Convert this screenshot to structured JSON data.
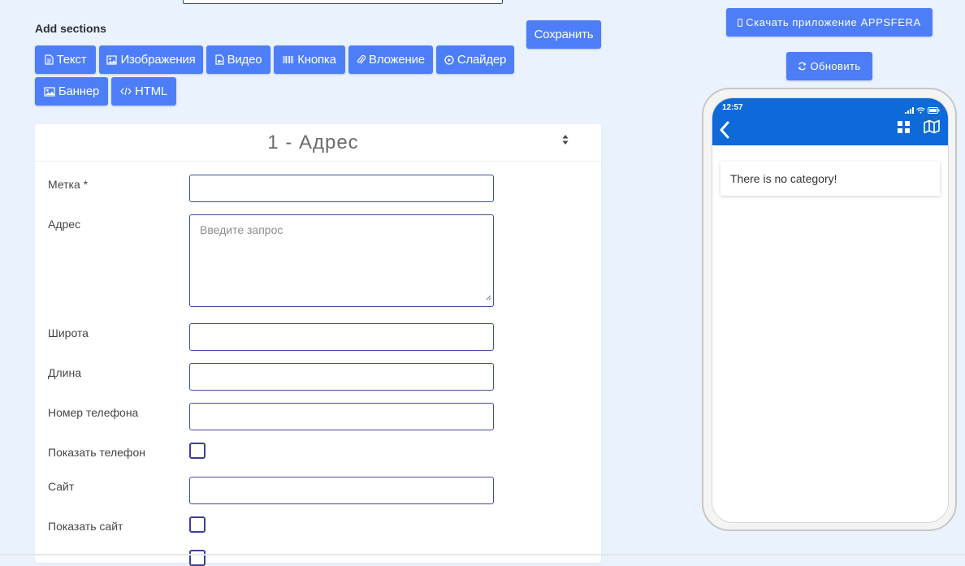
{
  "editor": {
    "add_sections_label": "Add sections",
    "save_label": "Сохранить",
    "section_buttons": [
      {
        "label": "Текст",
        "icon": "file-text-icon"
      },
      {
        "label": "Изображения",
        "icon": "image-icon"
      },
      {
        "label": "Видео",
        "icon": "video-file-icon"
      },
      {
        "label": "Кнопка",
        "icon": "barcode-icon"
      },
      {
        "label": "Вложение",
        "icon": "paperclip-icon"
      },
      {
        "label": "Слайдер",
        "icon": "play-circle-icon"
      },
      {
        "label": "Баннер",
        "icon": "picture-icon"
      },
      {
        "label": "HTML",
        "icon": "code-icon"
      }
    ]
  },
  "section": {
    "title": "1 - Адрес",
    "fields": {
      "label": {
        "label": "Метка *",
        "value": ""
      },
      "address": {
        "label": "Адрес",
        "placeholder": "Введите запрос",
        "value": ""
      },
      "latitude": {
        "label": "Широта",
        "value": ""
      },
      "longitude": {
        "label": "Длина",
        "value": ""
      },
      "phone": {
        "label": "Номер телефона",
        "value": ""
      },
      "show_phone": {
        "label": "Показать телефон",
        "checked": false
      },
      "site": {
        "label": "Сайт",
        "value": ""
      },
      "show_site": {
        "label": "Показать сайт",
        "checked": false
      }
    }
  },
  "preview": {
    "download_label": "Скачать приложение APPSFERA",
    "refresh_label": "Обновить",
    "phone": {
      "time": "12:57",
      "empty_message": "There is no category!"
    }
  },
  "colors": {
    "button": "#4d7ef7",
    "phone_header": "#0d6ad8",
    "background": "#eaf2fd"
  }
}
